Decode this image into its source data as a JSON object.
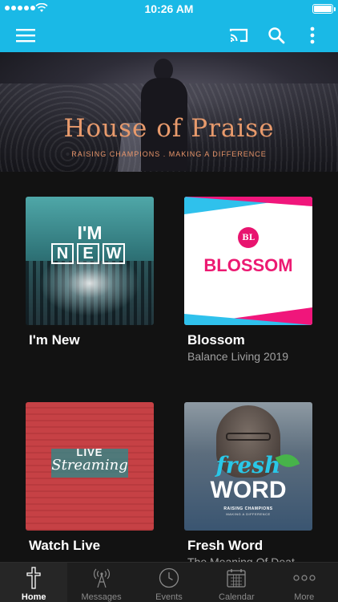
{
  "status_bar": {
    "time": "10:26 AM"
  },
  "app_bar": {
    "icons": [
      "menu-icon",
      "cast-icon",
      "search-icon",
      "more-vertical-icon"
    ],
    "color": "#1ab9e6"
  },
  "hero": {
    "title": "House of Praise",
    "subtitle": "RAISING CHAMPIONS . MAKING A DIFFERENCE"
  },
  "cards": [
    {
      "title": "I'm New",
      "subtitle": "",
      "art": {
        "line1": "I'M",
        "letters": [
          "N",
          "E",
          "W"
        ]
      }
    },
    {
      "title": "Blossom",
      "subtitle": "Balance Living 2019",
      "art": {
        "logo": "BL",
        "word": "BLOSSOM"
      }
    },
    {
      "title": "Watch Live",
      "subtitle": "",
      "art": {
        "line1": "LIVE",
        "line2": "Streaming"
      }
    },
    {
      "title": "Fresh Word",
      "subtitle": "The Meaning Of Deat",
      "art": {
        "line1": "fresh",
        "line2": "WORD",
        "tag1": "RAISING CHAMPIONS",
        "tag2": "MAKING A DIFFERENCE"
      }
    }
  ],
  "tabs": [
    {
      "label": "Home",
      "icon": "cross-icon",
      "active": true
    },
    {
      "label": "Messages",
      "icon": "broadcast-tower-icon",
      "active": false
    },
    {
      "label": "Events",
      "icon": "clock-icon",
      "active": false
    },
    {
      "label": "Calendar",
      "icon": "calendar-icon",
      "active": false
    },
    {
      "label": "More",
      "icon": "more-horizontal-icon",
      "active": false
    }
  ],
  "colors": {
    "accent": "#1ab9e6",
    "background": "#121212",
    "blossom_pink": "#ec1a72",
    "fresh_blue": "#29c7e8"
  }
}
